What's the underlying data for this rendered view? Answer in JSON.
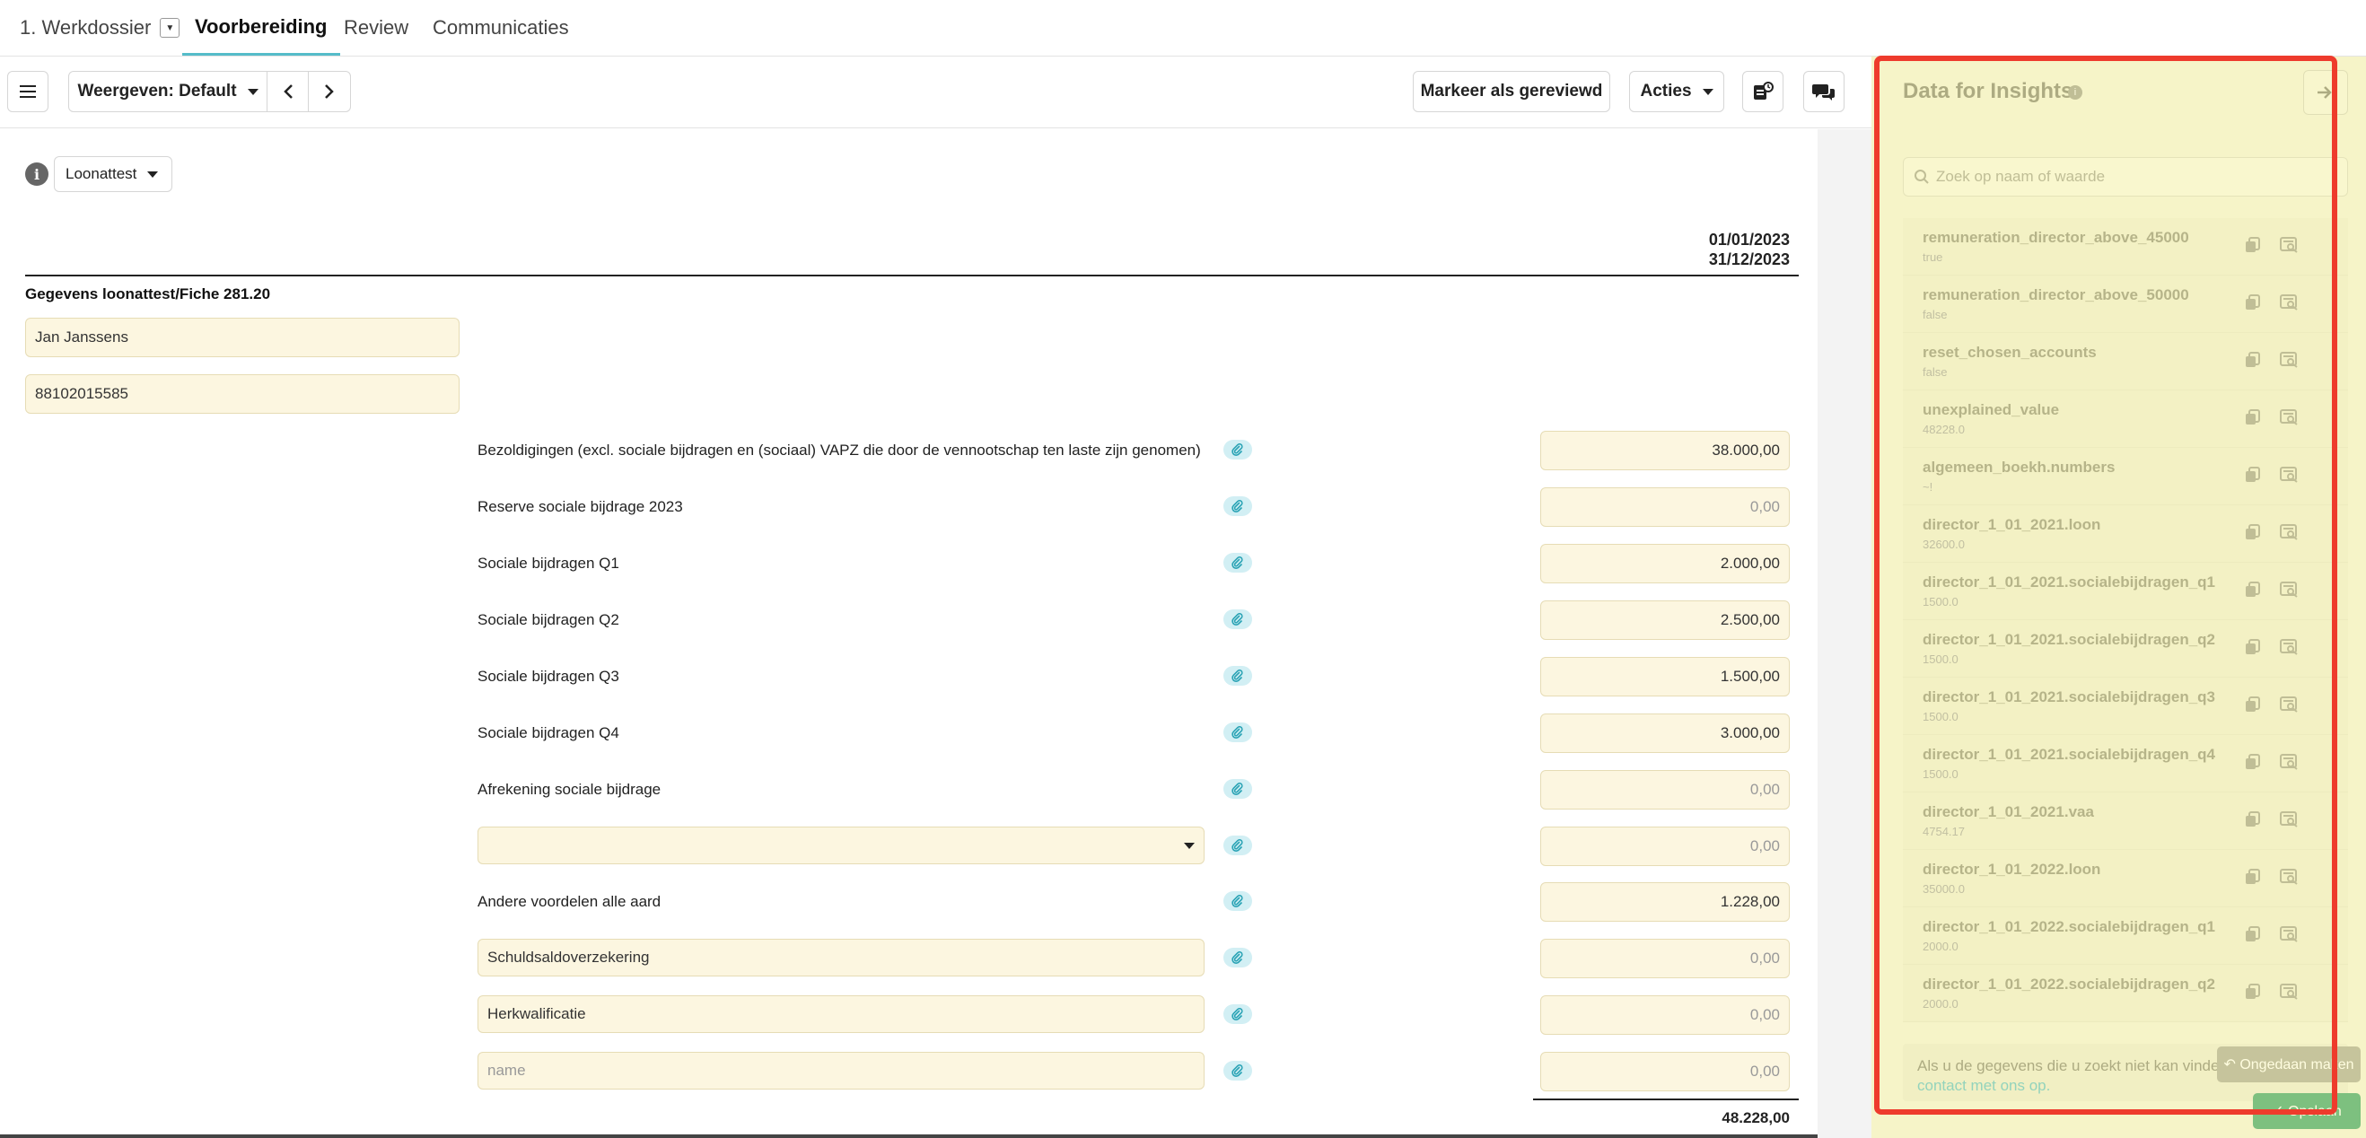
{
  "tabs": [
    {
      "label": "1. Werkdossier",
      "active": false
    },
    {
      "label": "Voorbereiding",
      "active": true
    },
    {
      "label": "Review",
      "active": false
    },
    {
      "label": "Communicaties",
      "active": false
    }
  ],
  "toolbar": {
    "view_label": "Weergeven: Default",
    "mark_reviewed": "Markeer als gereviewd",
    "actions": "Acties"
  },
  "form": {
    "form_select": "Loonattest",
    "period_start": "01/01/2023",
    "period_end": "31/12/2023",
    "section_title": "Gegevens loonattest/Fiche 281.20",
    "name_value": "Jan Janssens",
    "id_value": "88102015585",
    "rows": [
      {
        "label": "Bezoldigingen (excl. sociale bijdragen en (sociaal) VAPZ die door de vennootschap ten laste zijn genomen)",
        "value": "38.000,00",
        "kind": "text"
      },
      {
        "label": "Reserve sociale bijdrage 2023",
        "value": "0,00",
        "kind": "text"
      },
      {
        "label": "Sociale bijdragen Q1",
        "value": "2.000,00",
        "kind": "text"
      },
      {
        "label": "Sociale bijdragen Q2",
        "value": "2.500,00",
        "kind": "text"
      },
      {
        "label": "Sociale bijdragen Q3",
        "value": "1.500,00",
        "kind": "text"
      },
      {
        "label": "Sociale bijdragen Q4",
        "value": "3.000,00",
        "kind": "text"
      },
      {
        "label": "Afrekening sociale bijdrage",
        "value": "0,00",
        "kind": "text"
      },
      {
        "label": "",
        "value": "0,00",
        "kind": "select"
      },
      {
        "label": "Andere voordelen alle aard",
        "value": "1.228,00",
        "kind": "text"
      },
      {
        "label": "Schuldsaldoverzekering",
        "value": "0,00",
        "kind": "input"
      },
      {
        "label": "Herkwalificatie",
        "value": "0,00",
        "kind": "input"
      },
      {
        "label": "",
        "placeholder": "name",
        "value": "0,00",
        "kind": "input"
      }
    ],
    "total": "48.228,00"
  },
  "panel": {
    "title": "Data for Insights",
    "search_placeholder": "Zoek op naam of waarde",
    "items": [
      {
        "name": "remuneration_director_above_45000",
        "value": "true"
      },
      {
        "name": "remuneration_director_above_50000",
        "value": "false"
      },
      {
        "name": "reset_chosen_accounts",
        "value": "false"
      },
      {
        "name": "unexplained_value",
        "value": "48228.0"
      },
      {
        "name": "algemeen_boekh.numbers",
        "value": "~!"
      },
      {
        "name": "director_1_01_2021.loon",
        "value": "32600.0"
      },
      {
        "name": "director_1_01_2021.socialebijdragen_q1",
        "value": "1500.0"
      },
      {
        "name": "director_1_01_2021.socialebijdragen_q2",
        "value": "1500.0"
      },
      {
        "name": "director_1_01_2021.socialebijdragen_q3",
        "value": "1500.0"
      },
      {
        "name": "director_1_01_2021.socialebijdragen_q4",
        "value": "1500.0"
      },
      {
        "name": "director_1_01_2021.vaa",
        "value": "4754.17"
      },
      {
        "name": "director_1_01_2022.loon",
        "value": "35000.0"
      },
      {
        "name": "director_1_01_2022.socialebijdragen_q1",
        "value": "2000.0"
      },
      {
        "name": "director_1_01_2022.socialebijdragen_q2",
        "value": "2000.0"
      }
    ],
    "footer_text": "Als u de gegevens die u zoekt niet kan vinden,",
    "footer_link": "contact met ons op.",
    "undo_label": "↶ Ongedaan maken",
    "save_label": "✓ Opslaan"
  },
  "colors": {
    "accent": "#55bcc9",
    "highlight": "#ee3b2c",
    "field": "#fcf6e0"
  }
}
